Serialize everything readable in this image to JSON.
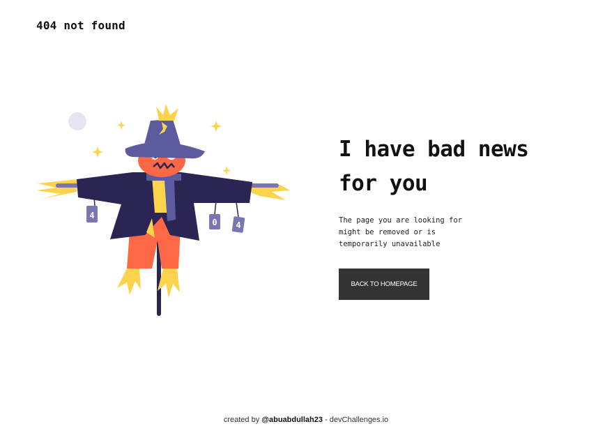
{
  "header": {
    "logo_text": "404 not found"
  },
  "main": {
    "headline_line1": "I have bad news",
    "headline_line2": "for you",
    "description": "The page you are looking for might be removed or is temporarily unavailable",
    "button_label": "BACK TO HOMEPAGE",
    "can_labels": [
      "4",
      "0",
      "4"
    ]
  },
  "footer": {
    "prefix": "created by ",
    "author": "@abuabdullah23",
    "separator": " - ",
    "site": "devChallenges.io"
  },
  "colors": {
    "text": "#111111",
    "button_bg": "#333333",
    "button_text": "#ffffff",
    "coat": "#2b2554",
    "hat": "#5d5ba0",
    "pumpkin": "#ff6845",
    "straw": "#fcd34d",
    "moon": "#e3e5f1"
  },
  "icons": [
    "scarecrow-illustration",
    "moon-icon",
    "sparkle-icon"
  ]
}
